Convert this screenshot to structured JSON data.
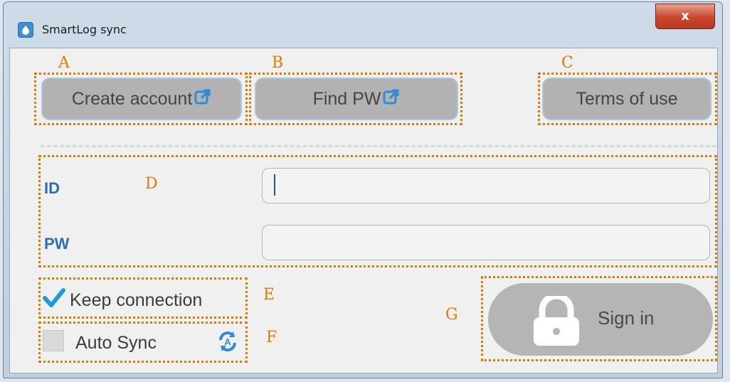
{
  "window": {
    "title": "SmartLog sync",
    "close_label": "x"
  },
  "toolbar": {
    "create_account_label": "Create account",
    "find_pw_label": "Find PW",
    "terms_label": "Terms of use"
  },
  "login": {
    "id_label": "ID",
    "id_value": "",
    "pw_label": "PW",
    "pw_value": ""
  },
  "options": {
    "keep_connection_label": "Keep connection",
    "keep_connection_checked": true,
    "auto_sync_label": "Auto Sync",
    "auto_sync_checked": false
  },
  "signin": {
    "label": "Sign in"
  },
  "annotations": [
    "A",
    "B",
    "C",
    "D",
    "E",
    "F",
    "G"
  ],
  "colors": {
    "annotation": "#e07b00",
    "field_label": "#2e6db4",
    "check_accent": "#1e9bd7",
    "button_gray": "#b2b2b2"
  },
  "icons": {
    "external_link": "external-link-icon",
    "lock": "lock-icon",
    "auto_sync": "auto-sync-icon"
  }
}
